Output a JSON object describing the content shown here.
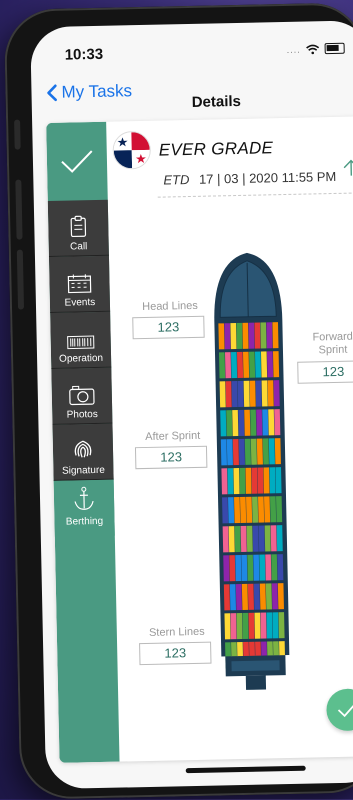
{
  "status": {
    "time": "10:33",
    "dots": "...."
  },
  "nav": {
    "back_label": "My Tasks",
    "title": "Details"
  },
  "vessel": {
    "name": "EVER GRADE",
    "etd_label": "ETD",
    "etd_value": "17 | 03 | 2020 11:55 PM",
    "flag_icon": "panama-flag"
  },
  "sidebar": {
    "items": [
      {
        "label": "Call",
        "icon": "clipboard-icon"
      },
      {
        "label": "Events",
        "icon": "calendar-icon"
      },
      {
        "label": "Operation",
        "icon": "barcode-icon"
      },
      {
        "label": "Photos",
        "icon": "camera-icon"
      },
      {
        "label": "Signature",
        "icon": "fingerprint-icon"
      },
      {
        "label": "Berthing",
        "icon": "anchor-icon"
      }
    ]
  },
  "fields": {
    "head_lines": {
      "label": "Head Lines",
      "value": "123"
    },
    "forward_sprint": {
      "label1": "Forward",
      "label2": "Sprint",
      "value": "123"
    },
    "after_sprint": {
      "label": "After Sprint",
      "value": "123"
    },
    "stern_lines": {
      "label": "Stern Lines",
      "value": "123"
    }
  },
  "colors": {
    "accent": "#4a9a82",
    "sidebar_dark": "#3c3c3c",
    "fab": "#5cbf8e",
    "link": "#1a73e8",
    "hull": "#1d3b52"
  }
}
